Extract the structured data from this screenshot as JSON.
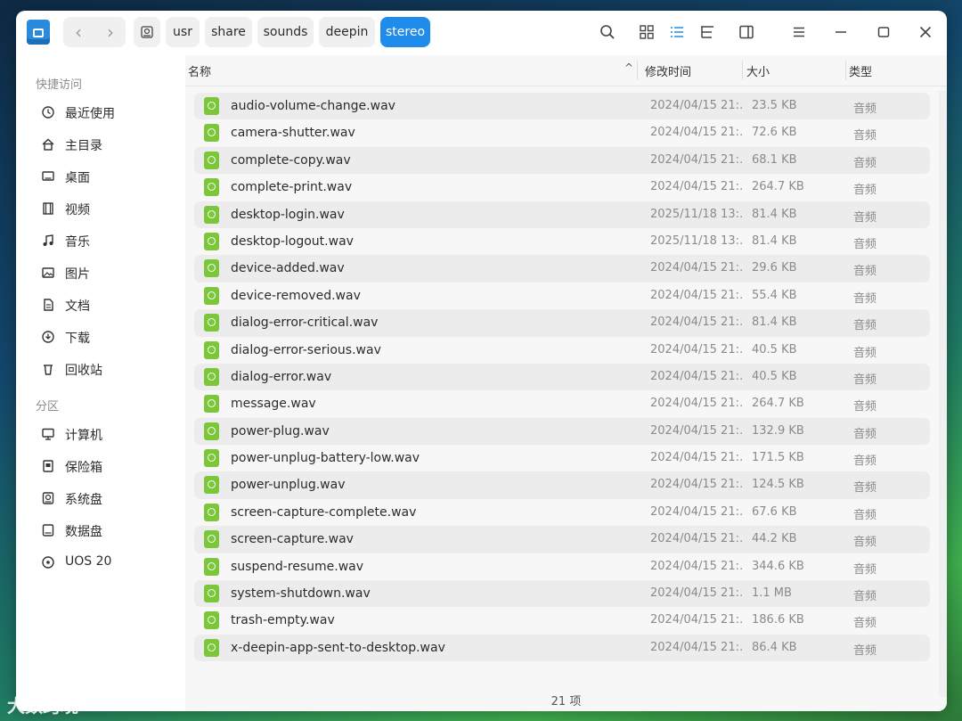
{
  "breadcrumb": {
    "items": [
      "usr",
      "share",
      "sounds",
      "deepin",
      "stereo"
    ],
    "active": "stereo"
  },
  "toolbar_icons": [
    "search-icon",
    "icon-view-icon",
    "list-view-icon",
    "tree-view-icon",
    "detail-panel-icon",
    "menu-icon",
    "minimize-icon",
    "maximize-icon",
    "close-icon"
  ],
  "sidebar": {
    "quick_access_title": "快捷访问",
    "quick_items": [
      {
        "label": "最近使用",
        "icon": "clock-icon"
      },
      {
        "label": "主目录",
        "icon": "home-icon"
      },
      {
        "label": "桌面",
        "icon": "desktop-icon"
      },
      {
        "label": "视频",
        "icon": "video-icon"
      },
      {
        "label": "音乐",
        "icon": "music-icon"
      },
      {
        "label": "图片",
        "icon": "picture-icon"
      },
      {
        "label": "文档",
        "icon": "document-icon"
      },
      {
        "label": "下载",
        "icon": "download-icon"
      },
      {
        "label": "回收站",
        "icon": "trash-icon"
      }
    ],
    "partition_title": "分区",
    "partition_items": [
      {
        "label": "计算机",
        "icon": "computer-icon"
      },
      {
        "label": "保险箱",
        "icon": "vault-icon"
      },
      {
        "label": "系统盘",
        "icon": "system-disk-icon"
      },
      {
        "label": "数据盘",
        "icon": "data-disk-icon"
      },
      {
        "label": "UOS 20",
        "icon": "optical-disc-icon",
        "eject": "▲"
      }
    ]
  },
  "columns": {
    "name": "名称",
    "modified": "修改时间",
    "size": "大小",
    "type": "类型"
  },
  "files": [
    {
      "name": "audio-volume-change.wav",
      "modified": "2024/04/15 21:…",
      "size": "23.5 KB",
      "type": "音频"
    },
    {
      "name": "camera-shutter.wav",
      "modified": "2024/04/15 21:…",
      "size": "72.6 KB",
      "type": "音频"
    },
    {
      "name": "complete-copy.wav",
      "modified": "2024/04/15 21:…",
      "size": "68.1 KB",
      "type": "音频"
    },
    {
      "name": "complete-print.wav",
      "modified": "2024/04/15 21:…",
      "size": "264.7 KB",
      "type": "音频"
    },
    {
      "name": "desktop-login.wav",
      "modified": "2025/11/18 13:…",
      "size": "81.4 KB",
      "type": "音频"
    },
    {
      "name": "desktop-logout.wav",
      "modified": "2025/11/18 13:…",
      "size": "81.4 KB",
      "type": "音频"
    },
    {
      "name": "device-added.wav",
      "modified": "2024/04/15 21:…",
      "size": "29.6 KB",
      "type": "音频"
    },
    {
      "name": "device-removed.wav",
      "modified": "2024/04/15 21:…",
      "size": "55.4 KB",
      "type": "音频"
    },
    {
      "name": "dialog-error-critical.wav",
      "modified": "2024/04/15 21:…",
      "size": "81.4 KB",
      "type": "音频"
    },
    {
      "name": "dialog-error-serious.wav",
      "modified": "2024/04/15 21:…",
      "size": "40.5 KB",
      "type": "音频"
    },
    {
      "name": "dialog-error.wav",
      "modified": "2024/04/15 21:…",
      "size": "40.5 KB",
      "type": "音频"
    },
    {
      "name": "message.wav",
      "modified": "2024/04/15 21:…",
      "size": "264.7 KB",
      "type": "音频"
    },
    {
      "name": "power-plug.wav",
      "modified": "2024/04/15 21:…",
      "size": "132.9 KB",
      "type": "音频"
    },
    {
      "name": "power-unplug-battery-low.wav",
      "modified": "2024/04/15 21:…",
      "size": "171.5 KB",
      "type": "音频"
    },
    {
      "name": "power-unplug.wav",
      "modified": "2024/04/15 21:…",
      "size": "124.5 KB",
      "type": "音频"
    },
    {
      "name": "screen-capture-complete.wav",
      "modified": "2024/04/15 21:…",
      "size": "67.6 KB",
      "type": "音频"
    },
    {
      "name": "screen-capture.wav",
      "modified": "2024/04/15 21:…",
      "size": "44.2 KB",
      "type": "音频"
    },
    {
      "name": "suspend-resume.wav",
      "modified": "2024/04/15 21:…",
      "size": "344.6 KB",
      "type": "音频"
    },
    {
      "name": "system-shutdown.wav",
      "modified": "2024/04/15 21:…",
      "size": "1.1 MB",
      "type": "音频"
    },
    {
      "name": "trash-empty.wav",
      "modified": "2024/04/15 21:…",
      "size": "186.6 KB",
      "type": "音频"
    },
    {
      "name": "x-deepin-app-sent-to-desktop.wav",
      "modified": "2024/04/15 21:…",
      "size": "86.4 KB",
      "type": "音频"
    }
  ],
  "status": {
    "count": "21 项"
  },
  "sort_indicator": "^",
  "watermark": "大数跨境",
  "colors": {
    "accent": "#1f8bea",
    "file_icon": "#7cc63a"
  }
}
